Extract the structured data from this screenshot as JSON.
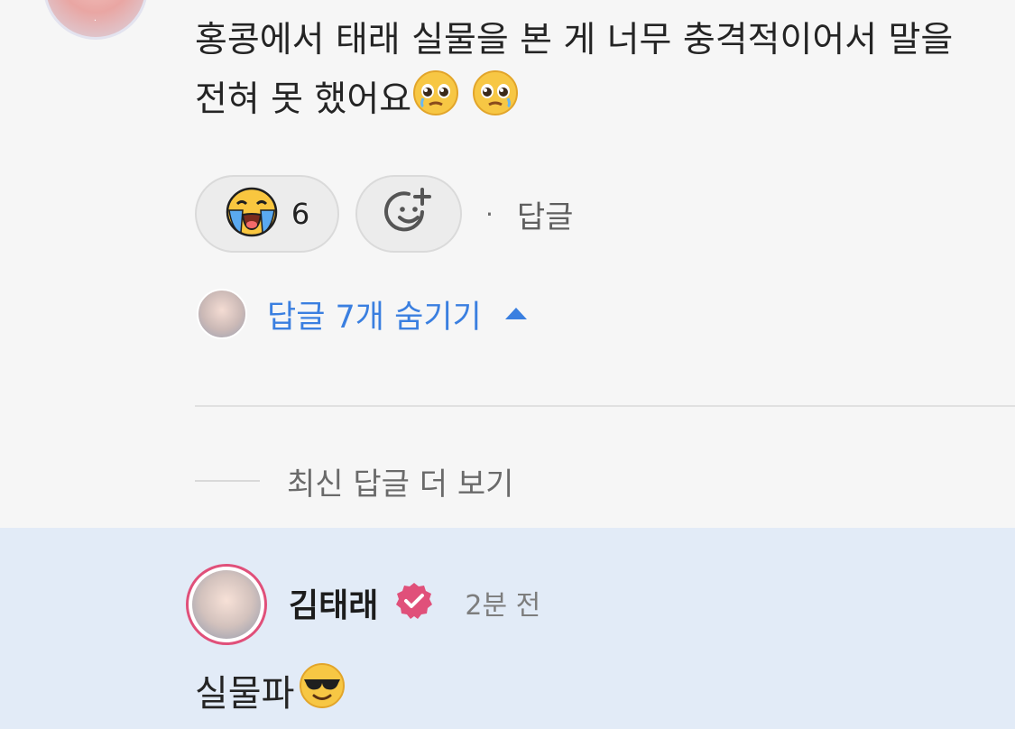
{
  "comment": {
    "text": "홍콩에서 태래 실물을 본 게 너무 충격적이어서 말을 전혀 못 했어요",
    "trailing_emojis": [
      "pleading-face-emoji",
      "pleading-face-emoji"
    ],
    "reaction": {
      "emoji": "loudly-crying-face-emoji",
      "count": "6"
    },
    "add_reaction_icon": "add-emoji-icon",
    "reply_label": "답글",
    "separator": "·"
  },
  "replies_toggle": {
    "label": "답글 7개 숨기기",
    "icon": "caret-up-icon"
  },
  "load_more": {
    "label": "최신 답글 더 보기"
  },
  "reply": {
    "author": "김태래",
    "verified_icon": "verified-badge-icon",
    "time": "2분 전",
    "text": "실물파",
    "emoji": "smiling-face-with-sunglasses-emoji"
  },
  "colors": {
    "link_blue": "#3a7fe0",
    "highlight_bg": "#e2ebf7",
    "verified_pink": "#e0507a",
    "page_bg": "#f6f6f6"
  }
}
